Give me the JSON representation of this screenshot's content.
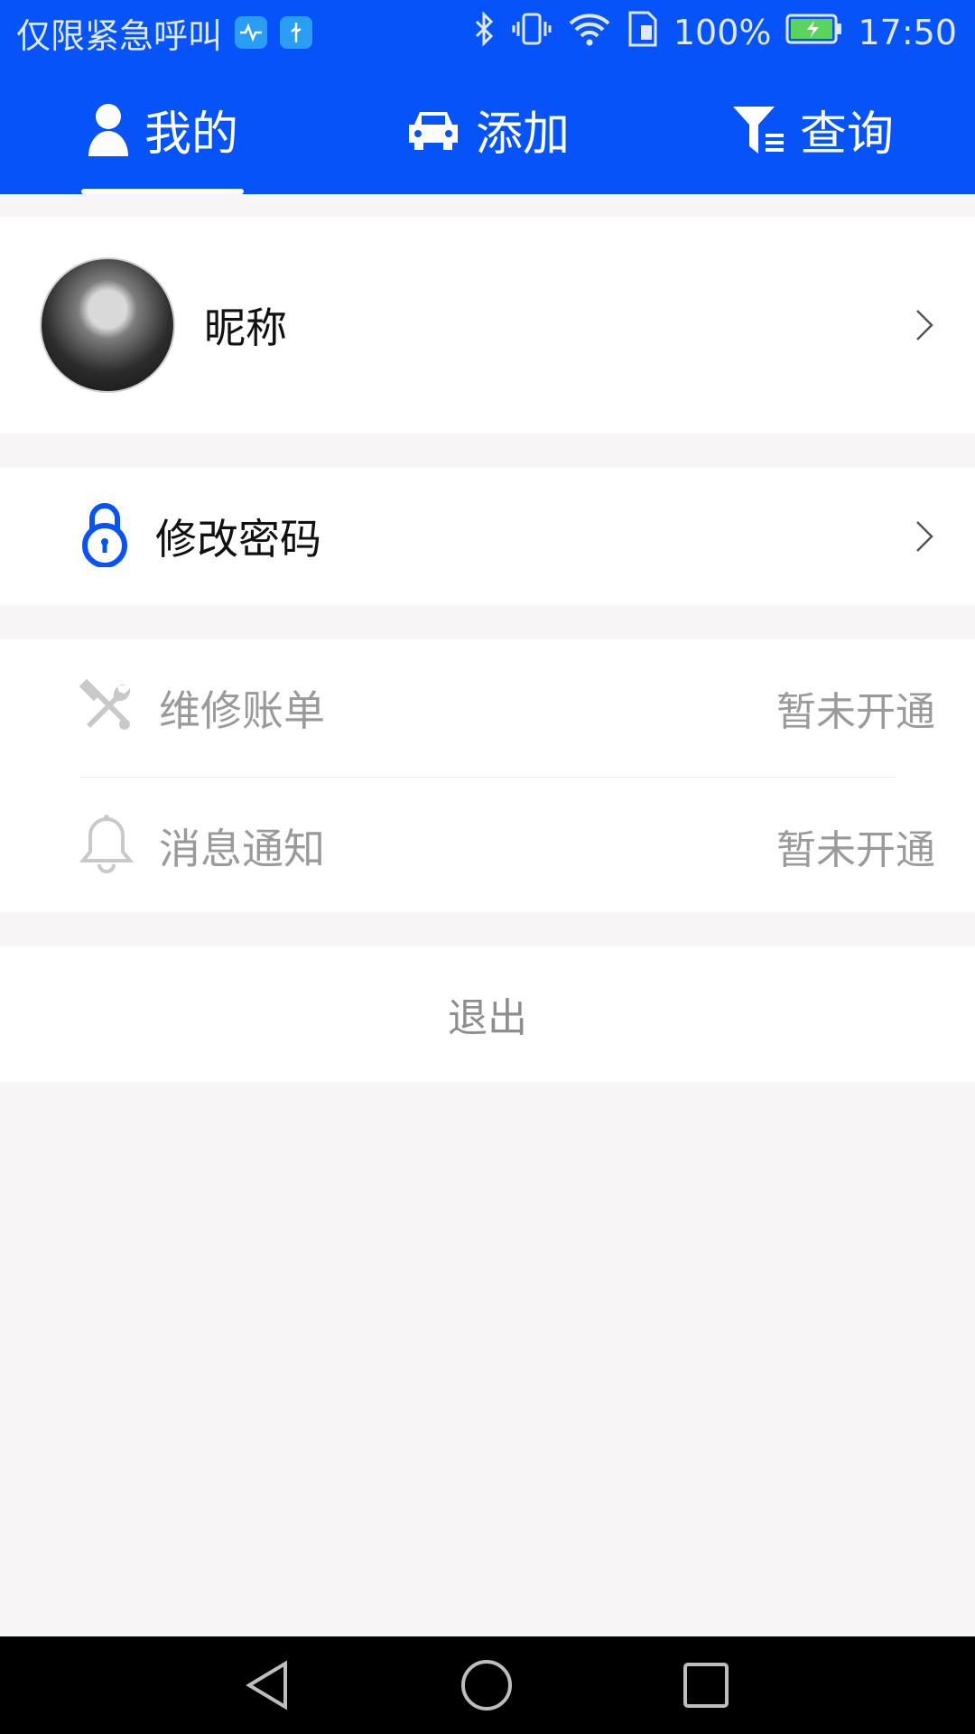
{
  "status": {
    "carrier_text": "仅限紧急呼叫",
    "battery": "100%",
    "time": "17:50"
  },
  "tabs": [
    {
      "label": "我的",
      "icon": "person-icon",
      "active": true
    },
    {
      "label": "添加",
      "icon": "car-icon",
      "active": false
    },
    {
      "label": "查询",
      "icon": "filter-icon",
      "active": false
    }
  ],
  "profile": {
    "nickname": "昵称"
  },
  "menu": {
    "change_password": "修改密码",
    "repair_bill": {
      "label": "维修账单",
      "status": "暂未开通"
    },
    "notifications": {
      "label": "消息通知",
      "status": "暂未开通"
    },
    "logout": "退出"
  },
  "colors": {
    "primary": "#0753fa",
    "background": "#f7f5f6"
  }
}
